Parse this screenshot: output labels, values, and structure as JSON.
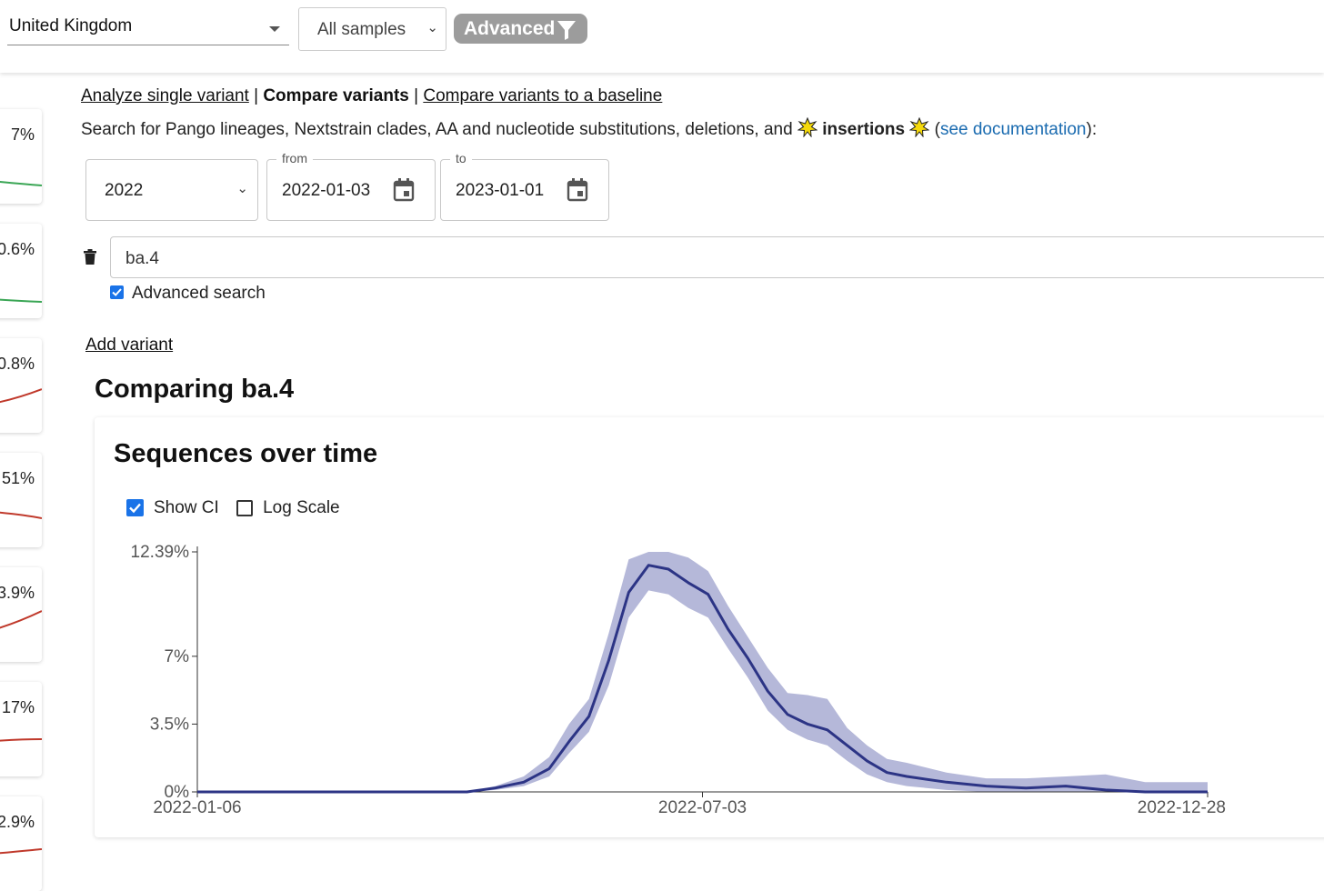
{
  "topbar": {
    "country": "United Kingdom",
    "samples": "All samples",
    "advanced_label": "Advanced"
  },
  "sidebar": {
    "cards": [
      {
        "value": "7%",
        "trend": "green"
      },
      {
        "value": "0.6%",
        "trend": "green"
      },
      {
        "value": "0.8%",
        "trend": "red"
      },
      {
        "value": "51%",
        "trend": "red"
      },
      {
        "value": "3.9%",
        "trend": "red"
      },
      {
        "value": "17%",
        "trend": "red"
      },
      {
        "value": "2.9%",
        "trend": "red"
      }
    ]
  },
  "nav": {
    "analyze_single": "Analyze single variant",
    "separator": "|",
    "compare_variants": "Compare variants",
    "compare_baseline": "Compare variants to a baseline"
  },
  "search_help": {
    "prefix": "Search for Pango lineages, Nextstrain clades, AA and nucleotide substitutions, deletions, and",
    "insertions": "insertions",
    "open_paren": "(",
    "doc_link": "see documentation",
    "suffix": "):"
  },
  "date_filter": {
    "year": "2022",
    "from_label": "from",
    "from_value": "2022-01-03",
    "to_label": "to",
    "to_value": "2023-01-01"
  },
  "variant": {
    "query": "ba.4",
    "advanced_search_label": "Advanced search",
    "add_variant_label": "Add variant"
  },
  "comparing_title": "Comparing ba.4",
  "chart_card": {
    "title": "Sequences over time",
    "show_ci_label": "Show CI",
    "log_scale_label": "Log Scale"
  },
  "colors": {
    "line": "#2c3485",
    "ci_band": "#b5b8d9",
    "link": "#1a6bb0",
    "checkbox": "#1a73e8"
  },
  "chart_data": {
    "type": "line",
    "title": "Sequences over time",
    "x_start": "2022-01-06",
    "x_end": "2022-12-28",
    "x_ticks": [
      "2022-01-06",
      "2022-07-03",
      "2022-12-28"
    ],
    "y_ticks": [
      "0%",
      "3.5%",
      "7%",
      "12.39%"
    ],
    "ylim": [
      0,
      12.39
    ],
    "ci_shown": true,
    "log_scale": false,
    "series": [
      {
        "x_dates": [
          "2022-01-06",
          "2022-04-11",
          "2022-04-21",
          "2022-05-01",
          "2022-05-10",
          "2022-05-17",
          "2022-05-24",
          "2022-05-31",
          "2022-06-07",
          "2022-06-14",
          "2022-06-21",
          "2022-06-28",
          "2022-07-05",
          "2022-07-12",
          "2022-07-19",
          "2022-07-26",
          "2022-08-02",
          "2022-08-09",
          "2022-08-16",
          "2022-08-23",
          "2022-08-30",
          "2022-09-06",
          "2022-09-13",
          "2022-09-27",
          "2022-10-11",
          "2022-10-25",
          "2022-11-08",
          "2022-11-22",
          "2022-12-06",
          "2022-12-28"
        ],
        "y": [
          0,
          0,
          0.2,
          0.5,
          1.2,
          2.6,
          3.9,
          6.8,
          10.3,
          11.7,
          11.5,
          10.8,
          10.2,
          8.4,
          6.9,
          5.2,
          4.0,
          3.5,
          3.2,
          2.4,
          1.6,
          1.0,
          0.8,
          0.5,
          0.3,
          0.2,
          0.3,
          0.1,
          0,
          0
        ],
        "ci_low": [
          0,
          0,
          0.1,
          0.3,
          0.8,
          2.0,
          3.1,
          5.5,
          9.0,
          10.4,
          10.2,
          9.5,
          9.0,
          7.4,
          5.9,
          4.2,
          3.2,
          2.7,
          2.4,
          1.6,
          0.9,
          0.5,
          0.3,
          0.1,
          0,
          0,
          0,
          0,
          0,
          0
        ],
        "ci_high": [
          0,
          0,
          0.3,
          0.8,
          1.8,
          3.5,
          4.8,
          8.2,
          12.0,
          12.39,
          12.39,
          12.1,
          11.4,
          9.6,
          8.0,
          6.4,
          5.1,
          5.0,
          4.8,
          3.3,
          2.4,
          1.7,
          1.5,
          1.0,
          0.7,
          0.7,
          0.8,
          0.9,
          0.5,
          0.5
        ]
      }
    ]
  }
}
